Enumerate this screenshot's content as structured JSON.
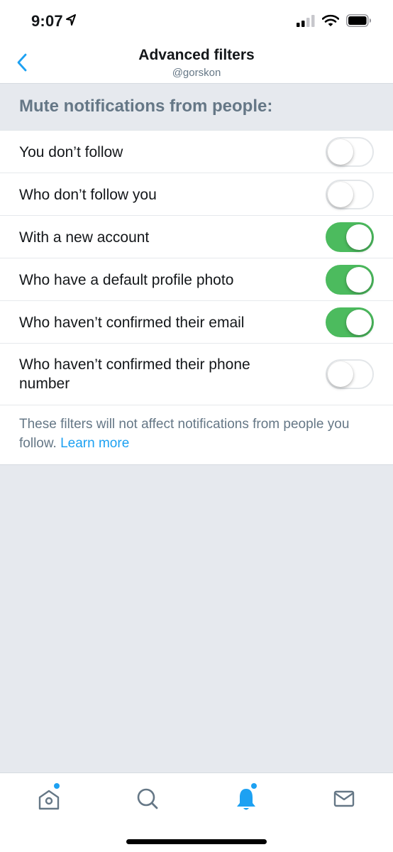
{
  "status_bar": {
    "time": "9:07",
    "icons": [
      "location-arrow-icon",
      "cellular-signal-icon",
      "wifi-icon",
      "battery-icon"
    ]
  },
  "header": {
    "title": "Advanced filters",
    "subtitle": "@gorskon",
    "back_icon": "chevron-left-icon"
  },
  "section": {
    "title": "Mute notifications from people:"
  },
  "filters": [
    {
      "label": "You don’t follow",
      "enabled": false
    },
    {
      "label": "Who don’t follow you",
      "enabled": false
    },
    {
      "label": "With a new account",
      "enabled": true
    },
    {
      "label": "Who have a default profile photo",
      "enabled": true
    },
    {
      "label": "Who haven’t confirmed their email",
      "enabled": true
    },
    {
      "label": "Who haven’t confirmed their phone number",
      "enabled": false
    }
  ],
  "footer": {
    "note": "These filters will not affect notifications from people you follow.",
    "link": "Learn more"
  },
  "tab_bar": {
    "tabs": [
      {
        "name": "home",
        "icon": "home-icon",
        "active": false,
        "has_dot": true
      },
      {
        "name": "search",
        "icon": "search-icon",
        "active": false,
        "has_dot": false
      },
      {
        "name": "notifications",
        "icon": "bell-icon",
        "active": true,
        "has_dot": true
      },
      {
        "name": "messages",
        "icon": "mail-icon",
        "active": false,
        "has_dot": false
      }
    ]
  },
  "colors": {
    "accent": "#1da1f2",
    "toggle_on": "#4cbb5e",
    "secondary_text": "#657786",
    "background": "#e6e9ee"
  }
}
